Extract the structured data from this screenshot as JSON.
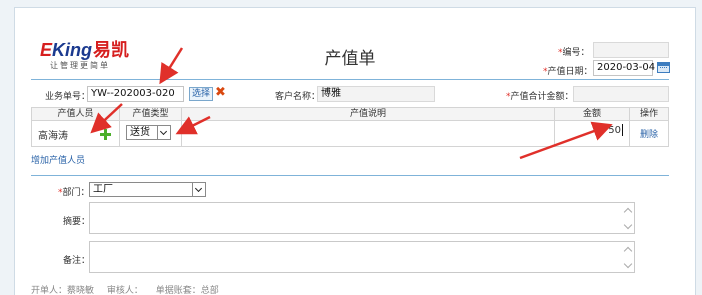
{
  "header": {
    "logo_brand": "EKing",
    "logo_cn": "易凯",
    "logo_slogan": "让管理更简单",
    "title": "产值单"
  },
  "top_right": {
    "number_label": "编号：",
    "number_value": "",
    "date_label": "产值日期：",
    "date_value": "2020-03-04"
  },
  "form": {
    "biz_no_label": "业务单号：",
    "biz_no_value": "YW--202003-020",
    "choose_label": "选择",
    "customer_label": "客户名称：",
    "customer_value": "博雅",
    "total_label": "产值合计金额：",
    "total_value": ""
  },
  "table": {
    "headers": [
      "产值人员",
      "产值类型",
      "产值说明",
      "金额",
      "操作"
    ],
    "row": {
      "person": "高海涛",
      "type": "送货",
      "desc": "",
      "amount": "50",
      "action": "删除"
    },
    "add_link": "增加产值人员"
  },
  "lower": {
    "dept_label": "部门：",
    "dept_value": "工厂",
    "summary_label": "摘要：",
    "summary_value": "",
    "remark_label": "备注：",
    "remark_value": ""
  },
  "footer": {
    "creator": "开单人：蔡晓敏",
    "reviewer": "审核人：",
    "ledger": "单据账套：总部"
  },
  "colors": {
    "brand_red": "#d61f1f",
    "brand_blue": "#1b3a8f",
    "required": "#e0302a",
    "link": "#2a63a8",
    "arrow": "#e0302a",
    "divider": "#7fb3d9"
  }
}
